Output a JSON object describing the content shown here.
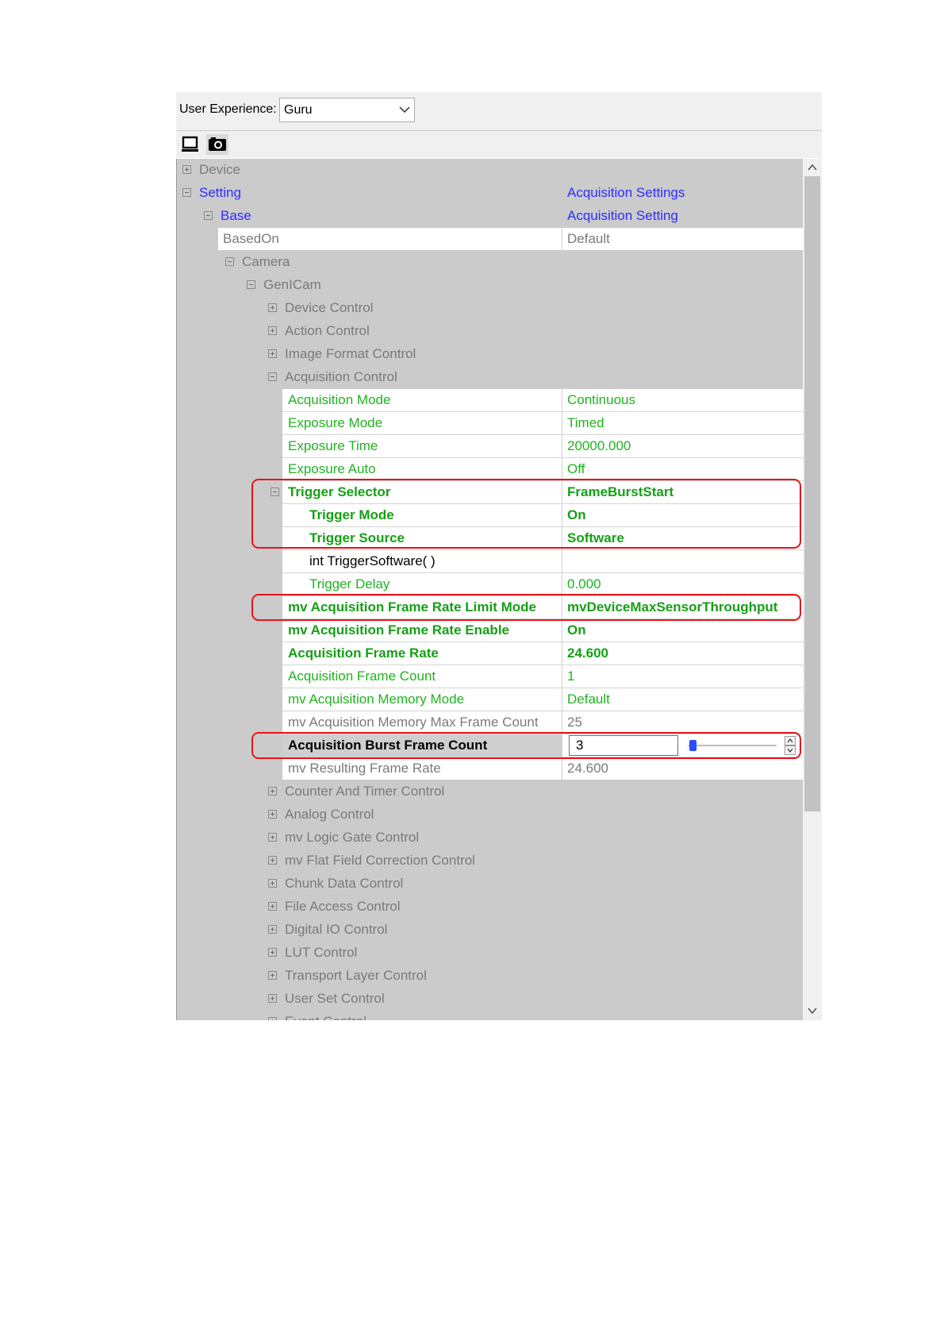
{
  "user_experience": {
    "label": "User Experience:",
    "value": "Guru"
  },
  "tree": {
    "device": "Device",
    "setting": {
      "name": "Setting",
      "value": "Acquisition Settings"
    },
    "base": {
      "name": "Base",
      "value": "Acquisition Setting"
    },
    "based_on": {
      "name": "BasedOn",
      "value": "Default"
    },
    "camera": "Camera",
    "genicam": "GenICam",
    "device_control": "Device Control",
    "action_control": "Action Control",
    "image_format_control": "Image Format Control",
    "acquisition_control": "Acquisition Control",
    "params": [
      {
        "name": "Acquisition Mode",
        "value": "Continuous"
      },
      {
        "name": "Exposure Mode",
        "value": "Timed"
      },
      {
        "name": "Exposure Time",
        "value": "20000.000"
      },
      {
        "name": "Exposure Auto",
        "value": "Off"
      },
      {
        "name": "Trigger Selector",
        "value": "FrameBurstStart"
      },
      {
        "name": "Trigger Mode",
        "value": "On"
      },
      {
        "name": "Trigger Source",
        "value": "Software"
      },
      {
        "name": "int TriggerSoftware( )",
        "value": ""
      },
      {
        "name": "Trigger Delay",
        "value": "0.000"
      },
      {
        "name": "mv Acquisition Frame Rate Limit Mode",
        "value": "mvDeviceMaxSensorThroughput"
      },
      {
        "name": "mv Acquisition Frame Rate Enable",
        "value": "On"
      },
      {
        "name": "Acquisition Frame Rate",
        "value": "24.600"
      },
      {
        "name": "Acquisition Frame Count",
        "value": "1"
      },
      {
        "name": "mv Acquisition Memory Mode",
        "value": "Default"
      },
      {
        "name": "mv Acquisition Memory Max Frame Count",
        "value": "25"
      },
      {
        "name": "Acquisition Burst Frame Count",
        "value": "3"
      },
      {
        "name": "mv Resulting Frame Rate",
        "value": "24.600"
      }
    ],
    "collapsed": [
      "Counter And Timer Control",
      "Analog Control",
      "mv Logic Gate Control",
      "mv Flat Field Correction Control",
      "Chunk Data Control",
      "File Access Control",
      "Digital IO Control",
      "LUT Control",
      "Transport Layer Control",
      "User Set Control",
      "Event Control"
    ]
  },
  "icons": {
    "toolbar": [
      "monitor-icon",
      "camera-icon"
    ]
  },
  "colors": {
    "highlight": "#e8131b",
    "green": "#1fb31f",
    "blue": "#2c2cff",
    "tree_bg": "#cbcbcb"
  }
}
